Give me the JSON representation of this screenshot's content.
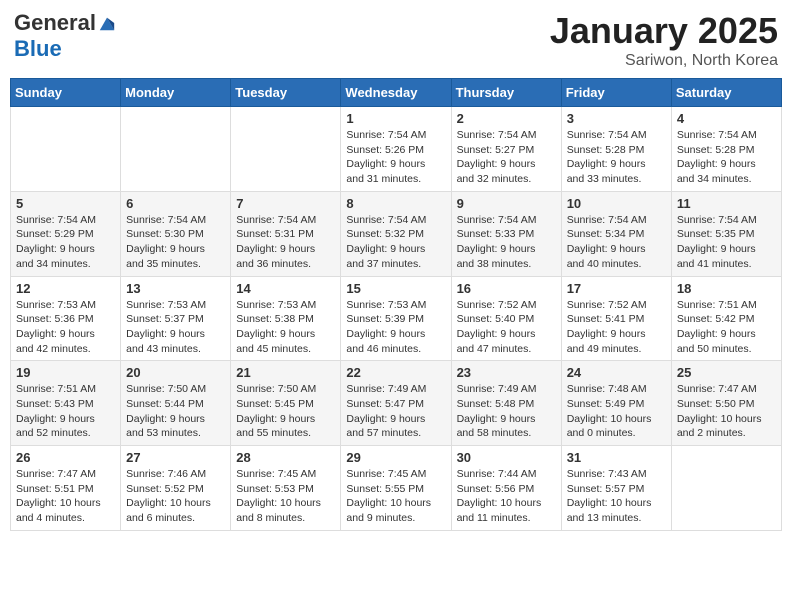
{
  "logo": {
    "general": "General",
    "blue": "Blue"
  },
  "title": "January 2025",
  "subtitle": "Sariwon, North Korea",
  "days_of_week": [
    "Sunday",
    "Monday",
    "Tuesday",
    "Wednesday",
    "Thursday",
    "Friday",
    "Saturday"
  ],
  "weeks": [
    [
      {
        "day": "",
        "info": ""
      },
      {
        "day": "",
        "info": ""
      },
      {
        "day": "",
        "info": ""
      },
      {
        "day": "1",
        "info": "Sunrise: 7:54 AM\nSunset: 5:26 PM\nDaylight: 9 hours and 31 minutes."
      },
      {
        "day": "2",
        "info": "Sunrise: 7:54 AM\nSunset: 5:27 PM\nDaylight: 9 hours and 32 minutes."
      },
      {
        "day": "3",
        "info": "Sunrise: 7:54 AM\nSunset: 5:28 PM\nDaylight: 9 hours and 33 minutes."
      },
      {
        "day": "4",
        "info": "Sunrise: 7:54 AM\nSunset: 5:28 PM\nDaylight: 9 hours and 34 minutes."
      }
    ],
    [
      {
        "day": "5",
        "info": "Sunrise: 7:54 AM\nSunset: 5:29 PM\nDaylight: 9 hours and 34 minutes."
      },
      {
        "day": "6",
        "info": "Sunrise: 7:54 AM\nSunset: 5:30 PM\nDaylight: 9 hours and 35 minutes."
      },
      {
        "day": "7",
        "info": "Sunrise: 7:54 AM\nSunset: 5:31 PM\nDaylight: 9 hours and 36 minutes."
      },
      {
        "day": "8",
        "info": "Sunrise: 7:54 AM\nSunset: 5:32 PM\nDaylight: 9 hours and 37 minutes."
      },
      {
        "day": "9",
        "info": "Sunrise: 7:54 AM\nSunset: 5:33 PM\nDaylight: 9 hours and 38 minutes."
      },
      {
        "day": "10",
        "info": "Sunrise: 7:54 AM\nSunset: 5:34 PM\nDaylight: 9 hours and 40 minutes."
      },
      {
        "day": "11",
        "info": "Sunrise: 7:54 AM\nSunset: 5:35 PM\nDaylight: 9 hours and 41 minutes."
      }
    ],
    [
      {
        "day": "12",
        "info": "Sunrise: 7:53 AM\nSunset: 5:36 PM\nDaylight: 9 hours and 42 minutes."
      },
      {
        "day": "13",
        "info": "Sunrise: 7:53 AM\nSunset: 5:37 PM\nDaylight: 9 hours and 43 minutes."
      },
      {
        "day": "14",
        "info": "Sunrise: 7:53 AM\nSunset: 5:38 PM\nDaylight: 9 hours and 45 minutes."
      },
      {
        "day": "15",
        "info": "Sunrise: 7:53 AM\nSunset: 5:39 PM\nDaylight: 9 hours and 46 minutes."
      },
      {
        "day": "16",
        "info": "Sunrise: 7:52 AM\nSunset: 5:40 PM\nDaylight: 9 hours and 47 minutes."
      },
      {
        "day": "17",
        "info": "Sunrise: 7:52 AM\nSunset: 5:41 PM\nDaylight: 9 hours and 49 minutes."
      },
      {
        "day": "18",
        "info": "Sunrise: 7:51 AM\nSunset: 5:42 PM\nDaylight: 9 hours and 50 minutes."
      }
    ],
    [
      {
        "day": "19",
        "info": "Sunrise: 7:51 AM\nSunset: 5:43 PM\nDaylight: 9 hours and 52 minutes."
      },
      {
        "day": "20",
        "info": "Sunrise: 7:50 AM\nSunset: 5:44 PM\nDaylight: 9 hours and 53 minutes."
      },
      {
        "day": "21",
        "info": "Sunrise: 7:50 AM\nSunset: 5:45 PM\nDaylight: 9 hours and 55 minutes."
      },
      {
        "day": "22",
        "info": "Sunrise: 7:49 AM\nSunset: 5:47 PM\nDaylight: 9 hours and 57 minutes."
      },
      {
        "day": "23",
        "info": "Sunrise: 7:49 AM\nSunset: 5:48 PM\nDaylight: 9 hours and 58 minutes."
      },
      {
        "day": "24",
        "info": "Sunrise: 7:48 AM\nSunset: 5:49 PM\nDaylight: 10 hours and 0 minutes."
      },
      {
        "day": "25",
        "info": "Sunrise: 7:47 AM\nSunset: 5:50 PM\nDaylight: 10 hours and 2 minutes."
      }
    ],
    [
      {
        "day": "26",
        "info": "Sunrise: 7:47 AM\nSunset: 5:51 PM\nDaylight: 10 hours and 4 minutes."
      },
      {
        "day": "27",
        "info": "Sunrise: 7:46 AM\nSunset: 5:52 PM\nDaylight: 10 hours and 6 minutes."
      },
      {
        "day": "28",
        "info": "Sunrise: 7:45 AM\nSunset: 5:53 PM\nDaylight: 10 hours and 8 minutes."
      },
      {
        "day": "29",
        "info": "Sunrise: 7:45 AM\nSunset: 5:55 PM\nDaylight: 10 hours and 9 minutes."
      },
      {
        "day": "30",
        "info": "Sunrise: 7:44 AM\nSunset: 5:56 PM\nDaylight: 10 hours and 11 minutes."
      },
      {
        "day": "31",
        "info": "Sunrise: 7:43 AM\nSunset: 5:57 PM\nDaylight: 10 hours and 13 minutes."
      },
      {
        "day": "",
        "info": ""
      }
    ]
  ]
}
